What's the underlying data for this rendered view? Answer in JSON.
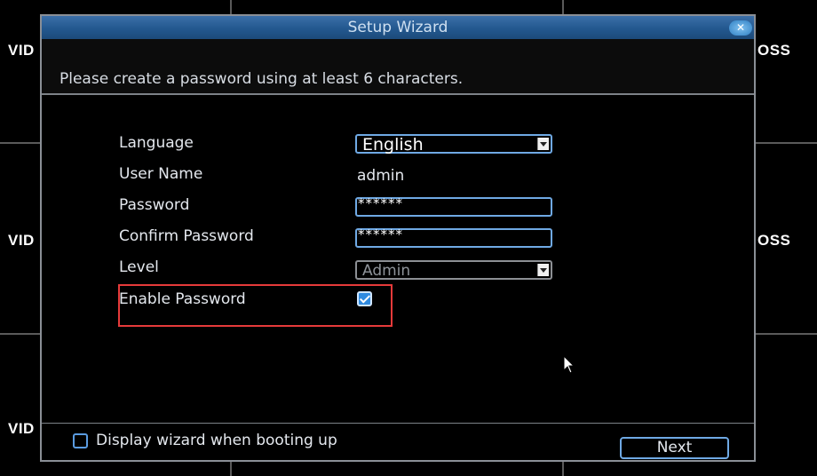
{
  "background": {
    "camera_labels_left": [
      "VID",
      "VID",
      "VID"
    ],
    "camera_labels_right": [
      "OSS",
      "OSS"
    ]
  },
  "dialog": {
    "title": "Setup Wizard",
    "close_icon": "close-icon",
    "hint": "Please create a password using at least 6 characters.",
    "fields": {
      "language": {
        "label": "Language",
        "value": "English"
      },
      "user_name": {
        "label": "User Name",
        "value": "admin"
      },
      "password": {
        "label": "Password",
        "value": "******"
      },
      "confirm_password": {
        "label": "Confirm Password",
        "value": "******"
      },
      "level": {
        "label": "Level",
        "value": "Admin"
      },
      "enable_password": {
        "label": "Enable Password",
        "checked": true
      }
    },
    "footer": {
      "display_wizard_label": "Display wizard when booting up",
      "display_wizard_checked": false,
      "next_label": "Next"
    }
  },
  "colors": {
    "accent": "#6fa9e4",
    "highlight": "#e63a3a",
    "titlebar": "#23588f"
  }
}
